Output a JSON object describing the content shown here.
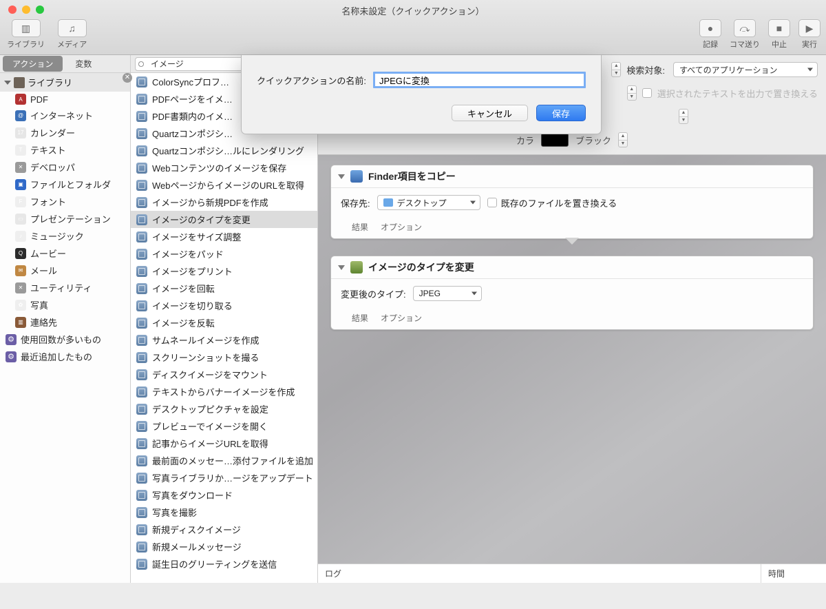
{
  "window": {
    "title": "名称未設定（クイックアクション）"
  },
  "toolbar": {
    "left": [
      {
        "id": "library",
        "label": "ライブラリ",
        "glyph": "▥"
      },
      {
        "id": "media",
        "label": "メディア",
        "glyph": "♫"
      }
    ],
    "right": [
      {
        "id": "record",
        "label": "記録",
        "glyph": "●"
      },
      {
        "id": "step",
        "label": "コマ送り",
        "glyph": "⤼"
      },
      {
        "id": "stop",
        "label": "中止",
        "glyph": "■"
      },
      {
        "id": "run",
        "label": "実行",
        "glyph": "▶"
      }
    ]
  },
  "tabs": {
    "actions": "アクション",
    "variables": "変数"
  },
  "search": {
    "value": "イメージ"
  },
  "library_header": "ライブラリ",
  "categories": [
    {
      "label": "PDF",
      "iconColor": "#b33232",
      "glyph": "A"
    },
    {
      "label": "インターネット",
      "iconColor": "#3b70b7",
      "glyph": "@"
    },
    {
      "label": "カレンダー",
      "iconColor": "#e6e6e6",
      "glyph": "17"
    },
    {
      "label": "テキスト",
      "iconColor": "#eeeeee",
      "glyph": "T"
    },
    {
      "label": "デベロッパ",
      "iconColor": "#9a9a9a",
      "glyph": "✕"
    },
    {
      "label": "ファイルとフォルダ",
      "iconColor": "#2f69c8",
      "glyph": "▣"
    },
    {
      "label": "フォント",
      "iconColor": "#efefef",
      "glyph": "F"
    },
    {
      "label": "プレゼンテーション",
      "iconColor": "#e7e7e7",
      "glyph": "▭"
    },
    {
      "label": "ミュージック",
      "iconColor": "#efefef",
      "glyph": "♪"
    },
    {
      "label": "ムービー",
      "iconColor": "#2b2b2b",
      "glyph": "Q"
    },
    {
      "label": "メール",
      "iconColor": "#c08843",
      "glyph": "✉"
    },
    {
      "label": "ユーティリティ",
      "iconColor": "#9a9a9a",
      "glyph": "✕"
    },
    {
      "label": "写真",
      "iconColor": "#efefef",
      "glyph": "✿"
    },
    {
      "label": "連絡先",
      "iconColor": "#8a5a38",
      "glyph": "▥"
    }
  ],
  "smart_groups": [
    {
      "label": "使用回数が多いもの"
    },
    {
      "label": "最近追加したもの"
    }
  ],
  "actions": [
    "ColorSyncプロフ…",
    "PDFページをイメ…",
    "PDF書類内のイメ…",
    "Quartzコンポジシ…",
    "Quartzコンポジシ…ルにレンダリング",
    "Webコンテンツのイメージを保存",
    "WebページからイメージのURLを取得",
    "イメージから新規PDFを作成",
    "イメージのタイプを変更",
    "イメージをサイズ調整",
    "イメージをパッド",
    "イメージをプリント",
    "イメージを回転",
    "イメージを切り取る",
    "イメージを反転",
    "サムネールイメージを作成",
    "スクリーンショットを撮る",
    "ディスクイメージをマウント",
    "テキストからバナーイメージを作成",
    "デスクトップピクチャを設定",
    "プレビューでイメージを開く",
    "記事からイメージURLを取得",
    "最前面のメッセー…添付ファイルを追加",
    "写真ライブラリか…ージをアップデート",
    "写真をダウンロード",
    "写真を撮影",
    "新規ディスクイメージ",
    "新規メールメッセージ",
    "誕生日のグリーティングを送信"
  ],
  "actions_selected_index": 8,
  "wf_controls": {
    "search_label": "検索対象:",
    "search_scope": "すべてのアプリケーション",
    "replace_checkbox": "選択されたテキストを出力で置き換える",
    "color_label": "カラ",
    "color_value": "ブラック"
  },
  "workflow": {
    "step1": {
      "title": "Finder項目をコピー",
      "dest_label": "保存先:",
      "dest_value": "デスクトップ",
      "replace_label": "既存のファイルを置き換える"
    },
    "step2": {
      "title": "イメージのタイプを変更",
      "type_label": "変更後のタイプ:",
      "type_value": "JPEG"
    },
    "foot_results": "結果",
    "foot_options": "オプション"
  },
  "logbar": {
    "log": "ログ",
    "time": "時間"
  },
  "dialog": {
    "label": "クイックアクションの名前:",
    "value": "JPEGに変換",
    "cancel": "キャンセル",
    "save": "保存"
  }
}
